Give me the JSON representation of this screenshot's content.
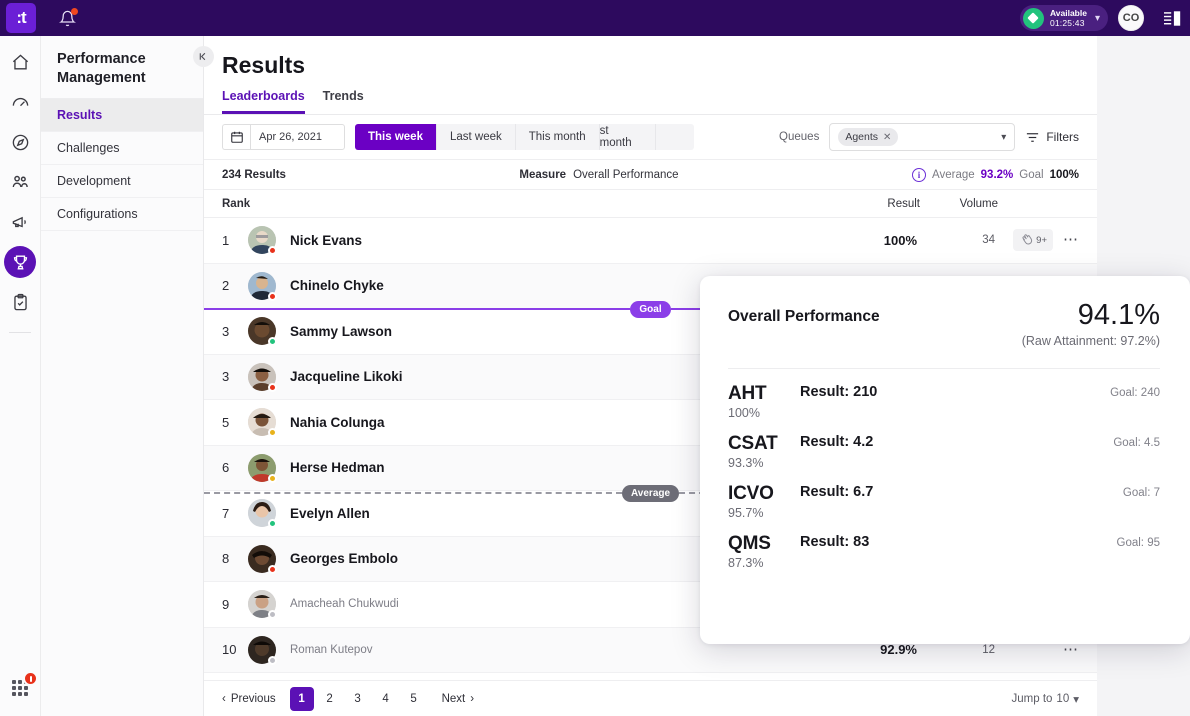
{
  "topbar": {
    "logo": ":t",
    "bell_icon": "bell-icon",
    "status": {
      "label": "Available",
      "timer": "01:25:43"
    },
    "avatar_initials": "CO",
    "panel_icon": "side-panel-icon"
  },
  "rail": {
    "items": [
      {
        "icon": "home-icon",
        "active": false
      },
      {
        "icon": "gauge-icon",
        "active": false
      },
      {
        "icon": "compass-icon",
        "active": false
      },
      {
        "icon": "people-icon",
        "active": false
      },
      {
        "icon": "megaphone-icon",
        "active": false
      },
      {
        "icon": "trophy-icon",
        "active": true
      },
      {
        "icon": "clipboard-icon",
        "active": false
      }
    ],
    "apps_icon": "apps-grid-icon"
  },
  "subnav": {
    "title": "Performance Management",
    "items": [
      {
        "label": "Results",
        "active": true
      },
      {
        "label": "Challenges",
        "active": false
      },
      {
        "label": "Development",
        "active": false
      },
      {
        "label": "Configurations",
        "active": false
      }
    ],
    "collapse_icon": "collapse-panel-icon"
  },
  "main": {
    "page_title": "Results",
    "tabs": [
      {
        "label": "Leaderboards",
        "active": true
      },
      {
        "label": "Trends",
        "active": false
      }
    ],
    "toolbar": {
      "calendar_icon": "calendar-icon",
      "date_value": "Apr 26, 2021",
      "ranges": [
        {
          "label": "This week",
          "active": true
        },
        {
          "label": "Last week",
          "active": false
        },
        {
          "label": "This month",
          "active": false
        },
        {
          "label": "st month",
          "active": false
        }
      ],
      "queues_label": "Queues",
      "queue_chip": "Agents",
      "queue_chip_remove": "✕",
      "filters_label": "Filters",
      "filters_icon": "filter-icon"
    },
    "meta": {
      "results_count": "234 Results",
      "measure_label": "Measure",
      "measure_value": "Overall Performance",
      "info_icon": "info-icon",
      "average_label": "Average",
      "average_value": "93.2%",
      "goal_label": "Goal",
      "goal_value": "100%"
    },
    "columns": {
      "rank": "Rank",
      "result": "Result",
      "volume": "Volume"
    },
    "rows": [
      {
        "rank": "1",
        "name": "Nick Evans",
        "status": "red",
        "result": "100%",
        "volume": "34",
        "faded": false,
        "reaction": "9+",
        "reaction_icon": "clap-icon"
      },
      {
        "rank": "2",
        "name": "Chinelo Chyke",
        "status": "red",
        "result": "",
        "volume": "",
        "faded": false
      },
      {
        "rank": "3",
        "name": "Sammy Lawson",
        "status": "green",
        "result": "",
        "volume": "",
        "faded": false
      },
      {
        "rank": "3",
        "name": "Jacqueline Likoki",
        "status": "red",
        "result": "",
        "volume": "",
        "faded": false
      },
      {
        "rank": "5",
        "name": "Nahia Colunga",
        "status": "yellow",
        "result": "",
        "volume": "",
        "faded": false
      },
      {
        "rank": "6",
        "name": "Herse Hedman",
        "status": "yellow",
        "result": "",
        "volume": "",
        "faded": false
      },
      {
        "rank": "7",
        "name": "Evelyn Allen",
        "status": "green",
        "result": "",
        "volume": "",
        "faded": false
      },
      {
        "rank": "8",
        "name": "Georges Embolo",
        "status": "red",
        "result": "",
        "volume": "",
        "faded": false
      },
      {
        "rank": "9",
        "name": "Amacheah Chukwudi",
        "status": "gray",
        "result": "",
        "volume": "",
        "faded": true
      },
      {
        "rank": "10",
        "name": "Roman Kutepov",
        "status": "gray",
        "result": "92.9%",
        "volume": "12",
        "faded": true
      }
    ],
    "markers": {
      "goal": "Goal",
      "average": "Average"
    },
    "pagination": {
      "previous": "Previous",
      "pages": [
        "1",
        "2",
        "3",
        "4",
        "5"
      ],
      "active_page": "1",
      "next": "Next",
      "jump_label": "Jump to",
      "jump_value": "10"
    }
  },
  "popup": {
    "title": "Overall Performance",
    "score": "94.1%",
    "raw": "(Raw Attainment: 97.2%)",
    "metrics": [
      {
        "name": "AHT",
        "pct": "100%",
        "result": "Result: 210",
        "goal": "Goal: 240",
        "fill": 96
      },
      {
        "name": "CSAT",
        "pct": "93.3%",
        "result": "Result: 4.2",
        "goal": "Goal: 4.5",
        "fill": 93.3
      },
      {
        "name": "ICVO",
        "pct": "95.7%",
        "result": "Result: 6.7",
        "goal": "Goal: 7",
        "fill": 98
      },
      {
        "name": "QMS",
        "pct": "87.3%",
        "result": "Result: 83",
        "goal": "Goal: 95",
        "fill": 87.3
      }
    ]
  },
  "colors": {
    "brand_purple": "#5b11b5",
    "topbar_purple": "#2d0a5e",
    "goal_purple": "#8b3ee8",
    "green": "#21c281",
    "status_green": "#22c37d",
    "alert_red": "#e8321b"
  }
}
